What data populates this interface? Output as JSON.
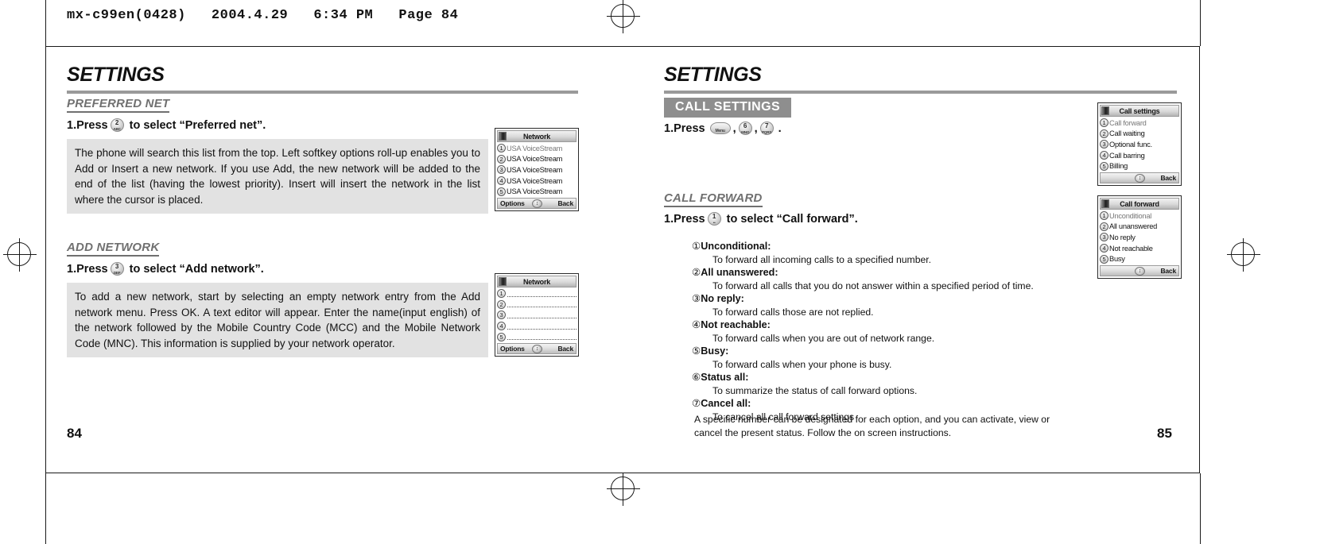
{
  "sheet": {
    "header": "mx-c99en(0428)   2004.4.29   6:34 PM   Page 84"
  },
  "left_page": {
    "title": "SETTINGS",
    "folio": "84",
    "sections": [
      {
        "subhead": "PREFERRED NET",
        "step_prefix": "1.Press",
        "key": {
          "number": "2",
          "sub": "ABC"
        },
        "step_suffix": "to select “Preferred net”.",
        "note": "The phone will search this list from the top. Left softkey options roll-up enables you to Add or Insert a new network. If you use Add, the new network will be added to the end of the list (having the lowest priority). Insert will insert the network in the list where the cursor is placed."
      },
      {
        "subhead": "ADD NETWORK",
        "step_prefix": "1.Press",
        "key": {
          "number": "3",
          "sub": "DEF"
        },
        "step_suffix": "to select “Add network”.",
        "note": "To add a new network, start by selecting an empty network entry from the Add network menu. Press OK. A text editor will appear. Enter the name(input english) of the network followed by the Mobile Country Code (MCC) and the Mobile Network Code (MNC). This information is supplied by your network operator."
      }
    ],
    "screens": [
      {
        "title": "Network",
        "rows": [
          {
            "num": "1",
            "label": "USA VoiceStream"
          },
          {
            "num": "2",
            "label": "USA VoiceStream"
          },
          {
            "num": "3",
            "label": "USA VoiceStream"
          },
          {
            "num": "4",
            "label": "USA VoiceStream"
          },
          {
            "num": "5",
            "label": "USA VoiceStream"
          }
        ],
        "left_soft": "Options",
        "right_soft": "Back"
      },
      {
        "title": "Network",
        "rows": [
          {
            "num": "1",
            "label": ""
          },
          {
            "num": "2",
            "label": ""
          },
          {
            "num": "3",
            "label": ""
          },
          {
            "num": "4",
            "label": ""
          },
          {
            "num": "5",
            "label": ""
          }
        ],
        "left_soft": "Options",
        "right_soft": "Back"
      }
    ]
  },
  "right_page": {
    "title": "SETTINGS",
    "folio": "85",
    "banner": "CALL SETTINGS",
    "banner_step_prefix": "1.Press",
    "banner_keys": [
      {
        "number": "",
        "sub": "Menu",
        "soft": true
      },
      {
        "number": "6",
        "sub": "MNO"
      },
      {
        "number": "7",
        "sub": "PQRS"
      }
    ],
    "banner_step_suffix": ".",
    "subhead": "CALL FORWARD",
    "step_prefix": "1.Press",
    "step_key": {
      "number": "1",
      "sub": "••"
    },
    "step_suffix": "to select “Call forward”.",
    "definitions": [
      {
        "num": "①",
        "term": "Unconditional:",
        "desc": "To forward all incoming calls to a specified number."
      },
      {
        "num": "②",
        "term": "All unanswered:",
        "desc": "To forward all calls that you do not answer within a specified period of time."
      },
      {
        "num": "③",
        "term": "No reply:",
        "desc": "To forward calls those are not replied."
      },
      {
        "num": "④",
        "term": "Not reachable:",
        "desc": "To forward calls when you are out of network range."
      },
      {
        "num": "⑤",
        "term": "Busy:",
        "desc": "To forward calls when your phone is busy."
      },
      {
        "num": "⑥",
        "term": "Status all:",
        "desc": "To summarize the status of call forward options."
      },
      {
        "num": "⑦",
        "term": "Cancel all:",
        "desc": "To cancel all call forward settings"
      }
    ],
    "closing": "A specific number can be designated for each option, and you can activate, view or cancel the present status. Follow the on screen instructions.",
    "screens": [
      {
        "title": "Call settings",
        "rows": [
          {
            "num": "1",
            "label": "Call forward"
          },
          {
            "num": "2",
            "label": "Call waiting"
          },
          {
            "num": "3",
            "label": "Optional func."
          },
          {
            "num": "4",
            "label": "Call barring"
          },
          {
            "num": "5",
            "label": "Billing"
          }
        ],
        "left_soft": "",
        "right_soft": "Back"
      },
      {
        "title": "Call forward",
        "rows": [
          {
            "num": "1",
            "label": "Unconditional"
          },
          {
            "num": "2",
            "label": "All unanswered"
          },
          {
            "num": "3",
            "label": "No reply"
          },
          {
            "num": "4",
            "label": "Not reachable"
          },
          {
            "num": "5",
            "label": "Busy"
          }
        ],
        "left_soft": "",
        "right_soft": "Back"
      }
    ]
  }
}
